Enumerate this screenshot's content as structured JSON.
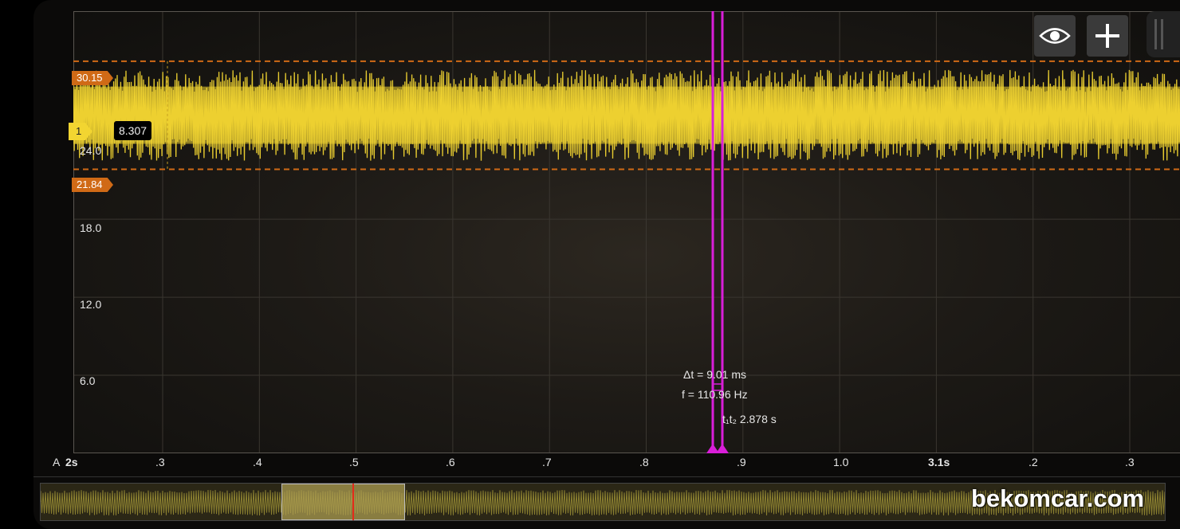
{
  "y_axis": {
    "unit": "A",
    "ticks": [
      {
        "label": "24.0",
        "value": 24.0
      },
      {
        "label": "18.0",
        "value": 18.0
      },
      {
        "label": "12.0",
        "value": 12.0
      },
      {
        "label": "6.0",
        "value": 6.0
      }
    ]
  },
  "x_axis": {
    "ticks": [
      {
        "label": "2s",
        "bold": true
      },
      {
        "label": ".3",
        "bold": false
      },
      {
        "label": ".4",
        "bold": false
      },
      {
        "label": ".5",
        "bold": false
      },
      {
        "label": ".6",
        "bold": false
      },
      {
        "label": ".7",
        "bold": false
      },
      {
        "label": ".8",
        "bold": false
      },
      {
        "label": ".9",
        "bold": false
      },
      {
        "label": "1.0",
        "bold": false
      },
      {
        "label": "3.1s",
        "bold": true
      },
      {
        "label": ".2",
        "bold": false
      },
      {
        "label": ".3",
        "bold": false
      }
    ]
  },
  "markers": {
    "upper": "30.15",
    "lower": "21.84"
  },
  "channel": {
    "tag": "1",
    "readout": "8.307",
    "color": "#f2d531"
  },
  "measurement": {
    "delta_t": "Δt = 9.01 ms",
    "frequency": "f = 110.96 Hz",
    "cursor_time": "t₁t₂ 2.878 s",
    "color": "#d91ed9"
  },
  "toolbar": {
    "visibility": "eye-icon",
    "add": "plus-icon"
  },
  "chart_data": {
    "type": "line",
    "title": "",
    "xlabel": "",
    "ylabel": "A",
    "ylim": [
      0,
      34
    ],
    "xlim": [
      2.2,
      3.33
    ],
    "series": [
      {
        "values_description_min": 22.5,
        "values_description_max": 29.5,
        "mean": 26.0
      }
    ],
    "x": [
      2.2,
      3.33
    ],
    "cursors": [
      2.87,
      2.879
    ]
  },
  "watermark": "bekomcar.com"
}
